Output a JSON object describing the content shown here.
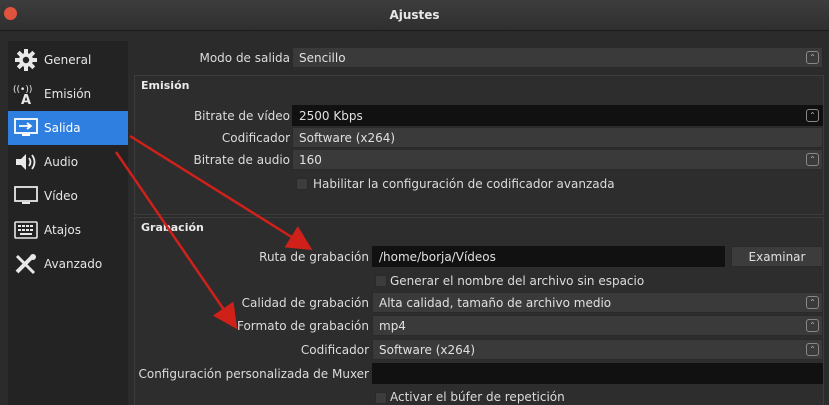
{
  "window": {
    "title": "Ajustes"
  },
  "sidebar": {
    "items": [
      {
        "label": "General",
        "icon": "gear-icon"
      },
      {
        "label": "Emisión",
        "icon": "broadcast-icon"
      },
      {
        "label": "Salida",
        "icon": "output-icon"
      },
      {
        "label": "Audio",
        "icon": "speaker-icon"
      },
      {
        "label": "Vídeo",
        "icon": "monitor-icon"
      },
      {
        "label": "Atajos",
        "icon": "keyboard-icon"
      },
      {
        "label": "Avanzado",
        "icon": "tools-icon"
      }
    ],
    "active_index": 2
  },
  "output": {
    "mode_label": "Modo de salida",
    "mode_value": "Sencillo"
  },
  "streaming": {
    "title": "Emisión",
    "video_bitrate_label": "Bitrate de vídeo",
    "video_bitrate_value": "2500 Kbps",
    "encoder_label": "Codificador",
    "encoder_value": "Software (x264)",
    "audio_bitrate_label": "Bitrate de audio",
    "audio_bitrate_value": "160",
    "advanced_encoder_label": "Habilitar la configuración de codificador avanzada"
  },
  "recording": {
    "title": "Grabación",
    "path_label": "Ruta de grabación",
    "path_value": "/home/borja/Vídeos",
    "browse_label": "Examinar",
    "no_space_label": "Generar el nombre del archivo sin espacio",
    "quality_label": "Calidad de grabación",
    "quality_value": "Alta calidad, tamaño de archivo medio",
    "format_label": "Formato de grabación",
    "format_value": "mp4",
    "encoder_label": "Codificador",
    "encoder_value": "Software (x264)",
    "muxer_label": "Configuración personalizada de Muxer",
    "muxer_value": "",
    "replay_buffer_label": "Activar el búfer de repetición"
  },
  "colors": {
    "accent": "#2f7fe0",
    "annotation_arrow": "#d0201a",
    "window_bg": "#2b2b2b"
  }
}
